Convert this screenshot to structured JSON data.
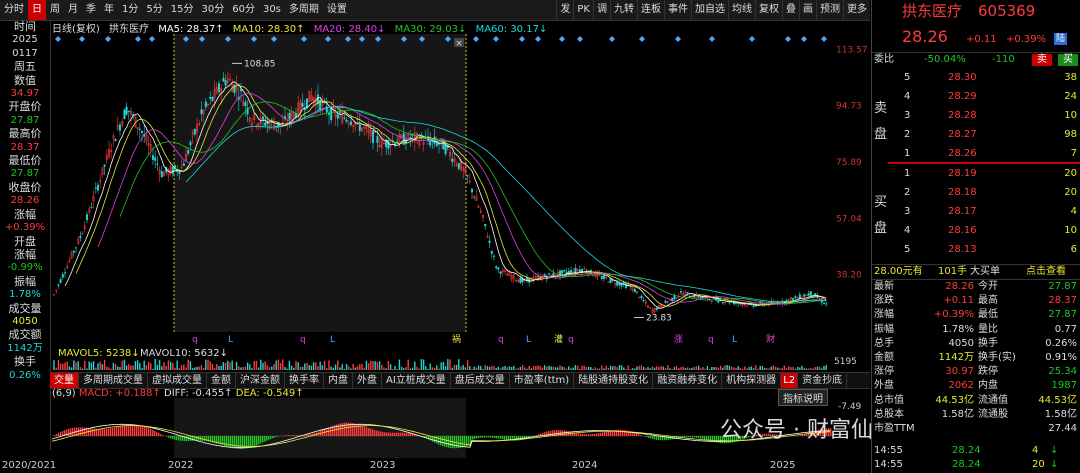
{
  "toolbar": {
    "left_items": [
      "分时",
      "日",
      "周",
      "月",
      "季",
      "年",
      "1分",
      "5分",
      "15分",
      "30分",
      "60分",
      "30s",
      "多周期",
      "设置"
    ],
    "active_index": 1,
    "right_items": [
      "发",
      "PK",
      "调",
      "九转",
      "连板",
      "事件",
      "加自选",
      "均线",
      "复权",
      "叠",
      "画",
      "预测",
      "更多"
    ]
  },
  "sidebar": {
    "items": [
      {
        "label": "时间",
        "value": "2025",
        "value2": "0117",
        "color": "#ddd"
      },
      {
        "label": "周五",
        "value": "",
        "color": "#ddd"
      },
      {
        "label": "数值",
        "value": "34.97",
        "color": "#ff3b3b"
      },
      {
        "label": "开盘价",
        "value": "27.87",
        "color": "#22c422"
      },
      {
        "label": "最高价",
        "value": "28.37",
        "color": "#ff3b3b"
      },
      {
        "label": "最低价",
        "value": "27.87",
        "color": "#22c422"
      },
      {
        "label": "收盘价",
        "value": "28.26",
        "color": "#ff3b3b"
      },
      {
        "label": "涨幅",
        "value": "+0.39%",
        "color": "#ff3b3b"
      },
      {
        "label": "开盘",
        "value": "",
        "color": "#ddd"
      },
      {
        "label": "涨幅",
        "value": "-0.99%",
        "color": "#22c422"
      },
      {
        "label": "振幅",
        "value": "1.78%",
        "color": "#1ed6d6"
      },
      {
        "label": "成交量",
        "value": "4050",
        "color": "#e8e838"
      },
      {
        "label": "成交额",
        "value": "1142万",
        "color": "#1ed6d6"
      },
      {
        "label": "换手",
        "value": "0.26%",
        "color": "#1ed6d6"
      }
    ]
  },
  "kheader": {
    "period": "日线(复权)",
    "name": "拱东医疗",
    "ma5": "MA5: 28.37↑",
    "ma10": "MA10: 28.30↑",
    "ma20": "MA20: 28.40↓",
    "ma30": "MA30: 29.03↓",
    "ma60": "MA60: 30.17↓"
  },
  "chart": {
    "price_ticks": [
      "113.57",
      "94.73",
      "75.89",
      "57.04",
      "38.20"
    ],
    "high_label": "108.85",
    "low_label": "23.83",
    "vol_label_right": "5195",
    "mavol": {
      "label": "MAVOL5: 5238↓",
      "label2": "MAVOL10: 5632↓"
    },
    "event_markers": [
      "q",
      "L",
      "q",
      "L",
      "祸",
      "q",
      "L",
      "灌",
      "q",
      "涨",
      "q",
      "L",
      "财"
    ]
  },
  "tabs": {
    "items": [
      "交量",
      "多周期成交量",
      "虚拟成交量",
      "金额",
      "沪深金额",
      "换手率",
      "内盘",
      "外盘",
      "AI立桩成交量",
      "盘后成交量",
      "市盈率(ttm)",
      "陆股通持股变化",
      "融资融券变化",
      "机构探测器",
      "资金抄底"
    ],
    "active_index": 0,
    "badge": "L2"
  },
  "macd": {
    "label": "(6,9)",
    "macd": "MACD: +0.188↑",
    "diff": "DIFF: -0.455↑",
    "dea": "DEA: -0.549↑",
    "help": "指标说明",
    "right_tick": "-7.49"
  },
  "bottom_axis": [
    "2020/2021",
    "2022",
    "2023",
    "2024",
    "2025"
  ],
  "right_panel": {
    "stock_name": "拱东医疗",
    "stock_code": "605369",
    "price": "28.26",
    "change": "+0.11",
    "change_pct": "+0.39%",
    "badge": "陆",
    "ratio_label": "委比",
    "ratio_pct": "-50.04%",
    "ratio_diff": "-110",
    "sell_btn": "卖",
    "buy_btn": "买",
    "sell_side_label": "卖盘",
    "buy_side_label": "买盘",
    "asks": [
      {
        "lvl": "5",
        "price": "28.30",
        "vol": "38"
      },
      {
        "lvl": "4",
        "price": "28.29",
        "vol": "24"
      },
      {
        "lvl": "3",
        "price": "28.28",
        "vol": "10"
      },
      {
        "lvl": "2",
        "price": "28.27",
        "vol": "98"
      },
      {
        "lvl": "1",
        "price": "28.26",
        "vol": "7"
      }
    ],
    "bids": [
      {
        "lvl": "1",
        "price": "28.19",
        "vol": "20"
      },
      {
        "lvl": "2",
        "price": "28.18",
        "vol": "20"
      },
      {
        "lvl": "3",
        "price": "28.17",
        "vol": "4"
      },
      {
        "lvl": "4",
        "price": "28.16",
        "vol": "10"
      },
      {
        "lvl": "5",
        "price": "28.13",
        "vol": "6"
      }
    ],
    "big_order": {
      "price": "28.00元有",
      "qty": "101手",
      "desc": "大买单",
      "link": "点击查看"
    },
    "stats": [
      {
        "l1": "最新",
        "v1": "28.26",
        "c1": "#ff3b3b",
        "l2": "今开",
        "v2": "27.87",
        "c2": "#22c422"
      },
      {
        "l1": "涨跌",
        "v1": "+0.11",
        "c1": "#ff3b3b",
        "l2": "最高",
        "v2": "28.37",
        "c2": "#ff3b3b"
      },
      {
        "l1": "涨幅",
        "v1": "+0.39%",
        "c1": "#ff3b3b",
        "l2": "最低",
        "v2": "27.87",
        "c2": "#22c422"
      },
      {
        "l1": "振幅",
        "v1": "1.78%",
        "c1": "#ddd",
        "l2": "量比",
        "v2": "0.77",
        "c2": "#ddd"
      },
      {
        "l1": "总手",
        "v1": "4050",
        "c1": "#ddd",
        "l2": "换手",
        "v2": "0.26%",
        "c2": "#ddd"
      },
      {
        "l1": "金额",
        "v1": "1142万",
        "c1": "#e8e838",
        "l2": "换手(实)",
        "v2": "0.91%",
        "c2": "#ddd"
      },
      {
        "l1": "涨停",
        "v1": "30.97",
        "c1": "#ff3b3b",
        "l2": "跌停",
        "v2": "25.34",
        "c2": "#22c422"
      },
      {
        "l1": "外盘",
        "v1": "2062",
        "c1": "#ff3b3b",
        "l2": "内盘",
        "v2": "1987",
        "c2": "#22c422"
      },
      {
        "l1": "总市值",
        "v1": "44.53亿",
        "c1": "#e8e838",
        "l2": "流通值",
        "v2": "44.53亿",
        "c2": "#e8e838"
      },
      {
        "l1": "总股本",
        "v1": "1.58亿",
        "c1": "#ddd",
        "l2": "流通股",
        "v2": "1.58亿",
        "c2": "#ddd"
      },
      {
        "l1": "市盈TTM",
        "v1": "",
        "c1": "#ddd",
        "l2": "",
        "v2": "27.44",
        "c2": "#ddd"
      }
    ],
    "ticks": [
      {
        "t": "14:55",
        "p": "28.24",
        "v": "4",
        "arrow": "↓",
        "c": "#22c422"
      },
      {
        "t": "14:55",
        "p": "28.24",
        "v": "20",
        "arrow": "↓",
        "c": "#22c422"
      }
    ]
  },
  "watermark": "公众号 · 财富仙解鲁"
}
